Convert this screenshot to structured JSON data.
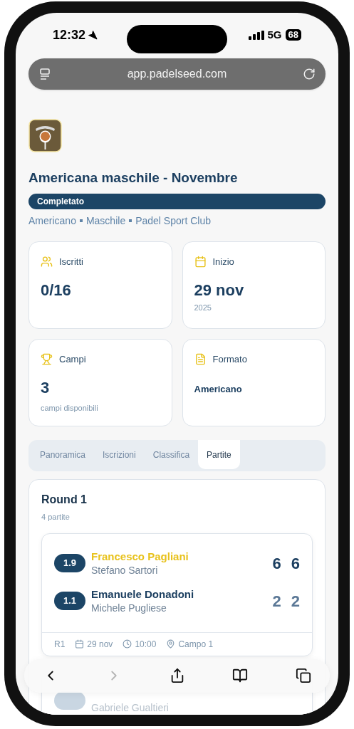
{
  "status_bar": {
    "time": "12:32",
    "network": "5G",
    "battery": "68"
  },
  "browser": {
    "url": "app.padelseed.com",
    "toolbar": [
      {
        "kind": "back",
        "disabled": false
      },
      {
        "kind": "forward",
        "disabled": true
      },
      {
        "kind": "share",
        "disabled": false
      },
      {
        "kind": "bookmarks",
        "disabled": false
      },
      {
        "kind": "tabs",
        "disabled": false
      }
    ]
  },
  "tournament": {
    "title": "Americana maschile - Novembre",
    "status": "Completato",
    "meta": [
      "Americano",
      "Maschile",
      "Padel Sport Club"
    ]
  },
  "stats": [
    {
      "kind": "users",
      "label": "Iscritti",
      "value": "0/16"
    },
    {
      "kind": "calendar",
      "label": "Inizio",
      "value": "29 nov",
      "sub": "2025"
    },
    {
      "kind": "trophy",
      "label": "Campi",
      "value": "3",
      "sub": "campi disponibili"
    },
    {
      "kind": "document",
      "label": "Formato",
      "value": "Americano",
      "small": true
    }
  ],
  "tabs": [
    {
      "label": "Panoramica",
      "selected": false
    },
    {
      "label": "Iscrizioni",
      "selected": false
    },
    {
      "label": "Classifica",
      "selected": false
    },
    {
      "label": "Partite",
      "selected": true
    }
  ],
  "round": {
    "title": "Round 1",
    "subtitle": "4 partite",
    "matches": [
      {
        "teams": [
          {
            "seed": "1.9",
            "name": "Francesco Pagliani",
            "partner": "Stefano Sartori",
            "winner": true,
            "scores": [
              "6",
              "6"
            ]
          },
          {
            "seed": "1.1",
            "name": "Emanuele Donadoni",
            "partner": "Michele Pugliese",
            "winner": false,
            "scores": [
              "2",
              "2"
            ]
          }
        ],
        "footer": {
          "round": "R1",
          "date": "29 nov",
          "time": "10:00",
          "court": "Campo 1"
        }
      },
      {
        "teams": [
          {
            "partner": "Gabriele Gualtieri"
          }
        ]
      }
    ]
  }
}
